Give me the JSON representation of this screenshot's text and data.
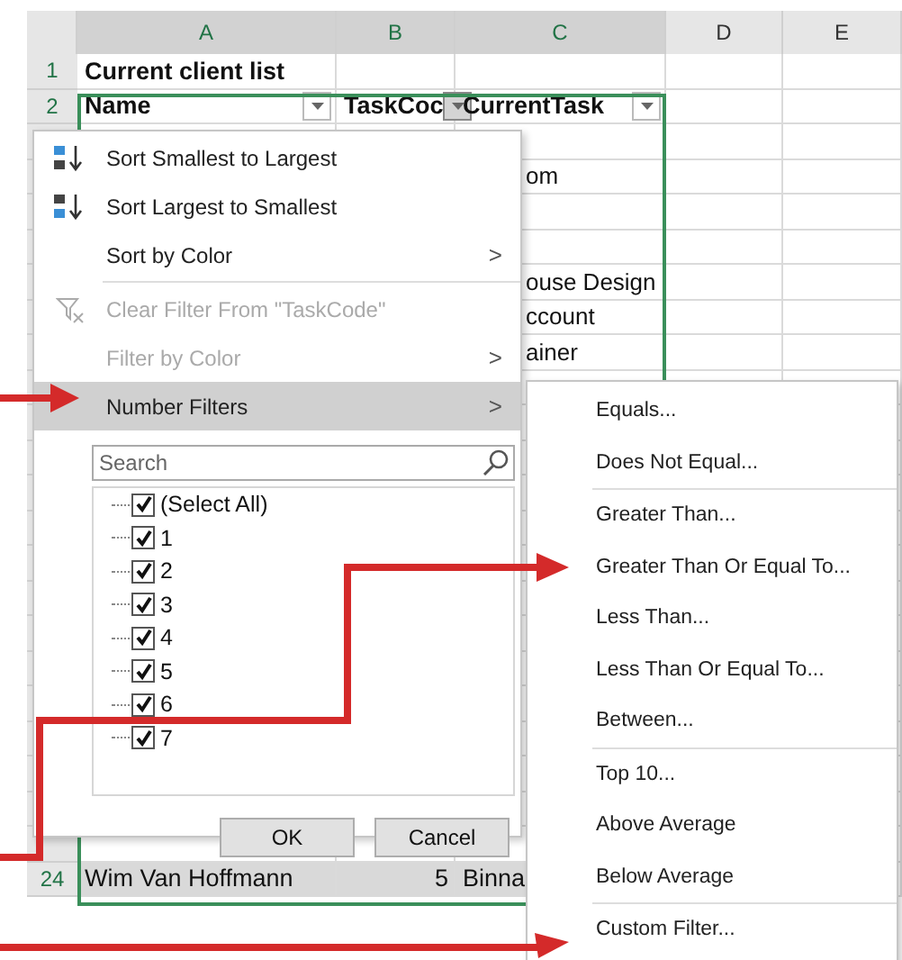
{
  "columns": [
    "A",
    "B",
    "C",
    "D",
    "E"
  ],
  "title_row": {
    "number": "1",
    "text": "Current client list"
  },
  "header_row": {
    "number": "2",
    "headers": [
      {
        "label": "Name",
        "selected": false
      },
      {
        "label": "TaskCoc",
        "selected": true
      },
      {
        "label": "CurrentTask",
        "selected": false
      }
    ]
  },
  "column_c_fragments": [
    "om",
    "ouse Design",
    "ccount",
    "ainer"
  ],
  "last_row": {
    "number": "24",
    "name": "Wim Van Hoffmann",
    "task_code": "5",
    "current_task": "Binna"
  },
  "filter_menu": {
    "groups": [
      [
        {
          "kind": "sort_ascending",
          "label": "Sort Smallest to Largest",
          "disabled": false,
          "submenu": false,
          "selected": false
        },
        {
          "kind": "sort_descending",
          "label": "Sort Largest to Smallest",
          "disabled": false,
          "submenu": false,
          "selected": false
        },
        {
          "kind": "plain",
          "label": "Sort by Color",
          "disabled": false,
          "submenu": true,
          "selected": false
        }
      ],
      [
        {
          "kind": "clear_filter",
          "label": "Clear Filter From \"TaskCode\"",
          "disabled": true,
          "submenu": false,
          "selected": false
        },
        {
          "kind": "plain",
          "label": "Filter by Color",
          "disabled": true,
          "submenu": true,
          "selected": false
        },
        {
          "kind": "plain",
          "label": "Number Filters",
          "disabled": false,
          "submenu": true,
          "selected": true
        }
      ]
    ],
    "submenu_glyph": ">",
    "search": {
      "placeholder": "Search"
    },
    "values": [
      {
        "label": "(Select All)",
        "checked": true
      },
      {
        "label": "1",
        "checked": true
      },
      {
        "label": "2",
        "checked": true
      },
      {
        "label": "3",
        "checked": true
      },
      {
        "label": "4",
        "checked": true
      },
      {
        "label": "5",
        "checked": true
      },
      {
        "label": "6",
        "checked": true
      },
      {
        "label": "7",
        "checked": true
      }
    ],
    "buttons": [
      "OK",
      "Cancel"
    ]
  },
  "number_filters_submenu": [
    [
      "Equals...",
      "Does Not Equal..."
    ],
    [
      "Greater Than...",
      "Greater Than Or Equal To...",
      "Less Than...",
      "Less Than Or Equal To...",
      "Between..."
    ],
    [
      "Top 10...",
      "Above Average",
      "Below Average"
    ],
    [
      "Custom Filter..."
    ]
  ]
}
